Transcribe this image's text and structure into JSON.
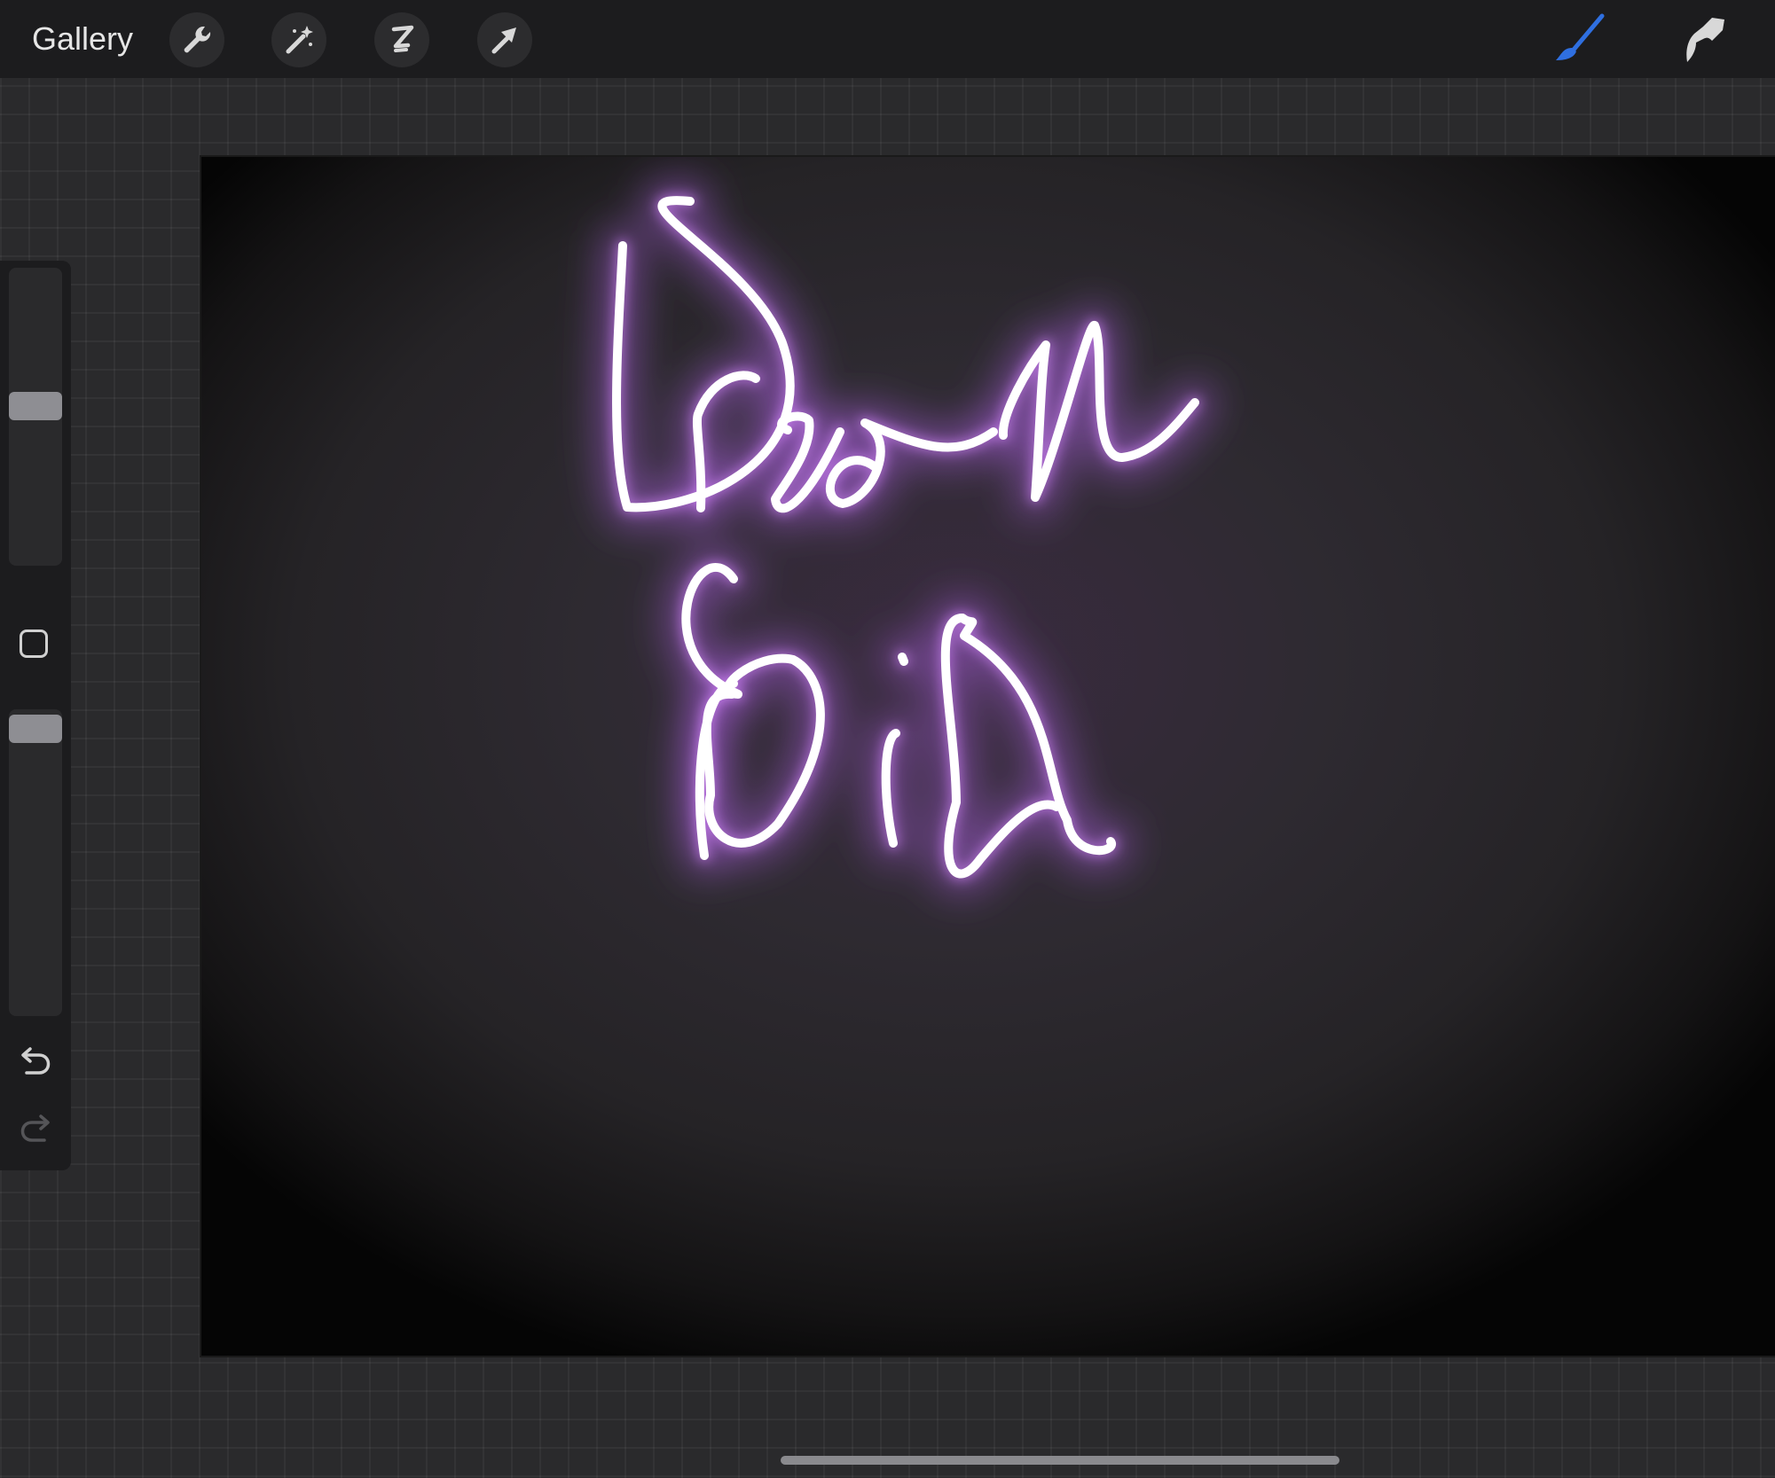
{
  "toolbar": {
    "gallery_label": "Gallery",
    "left_tools": [
      {
        "icon": "wrench-icon",
        "name": "actions"
      },
      {
        "icon": "magic-wand-icon",
        "name": "adjustments"
      },
      {
        "icon": "selection-icon",
        "name": "selection"
      },
      {
        "icon": "arrow-icon",
        "name": "transform"
      }
    ],
    "right_tools": [
      {
        "icon": "brush-icon",
        "name": "brush",
        "active": true,
        "color": "#2f6fe0"
      },
      {
        "icon": "smudge-icon",
        "name": "smudge",
        "active": false,
        "color": "#d8d8d8"
      }
    ]
  },
  "canvas": {
    "artwork_words": [
      "Dream",
      "Big"
    ],
    "glow_color": "#a05bd0",
    "stroke_color": "#ffffff"
  },
  "sidebar": {
    "brush_size_level": 0.55,
    "opacity_level": 0.95,
    "undo_icon": "undo-icon",
    "redo_icon": "redo-icon"
  },
  "colors": {
    "toolbar_bg": "#1c1c1e",
    "workspace_bg": "#2a2a2c",
    "accent": "#2f6fe0"
  }
}
